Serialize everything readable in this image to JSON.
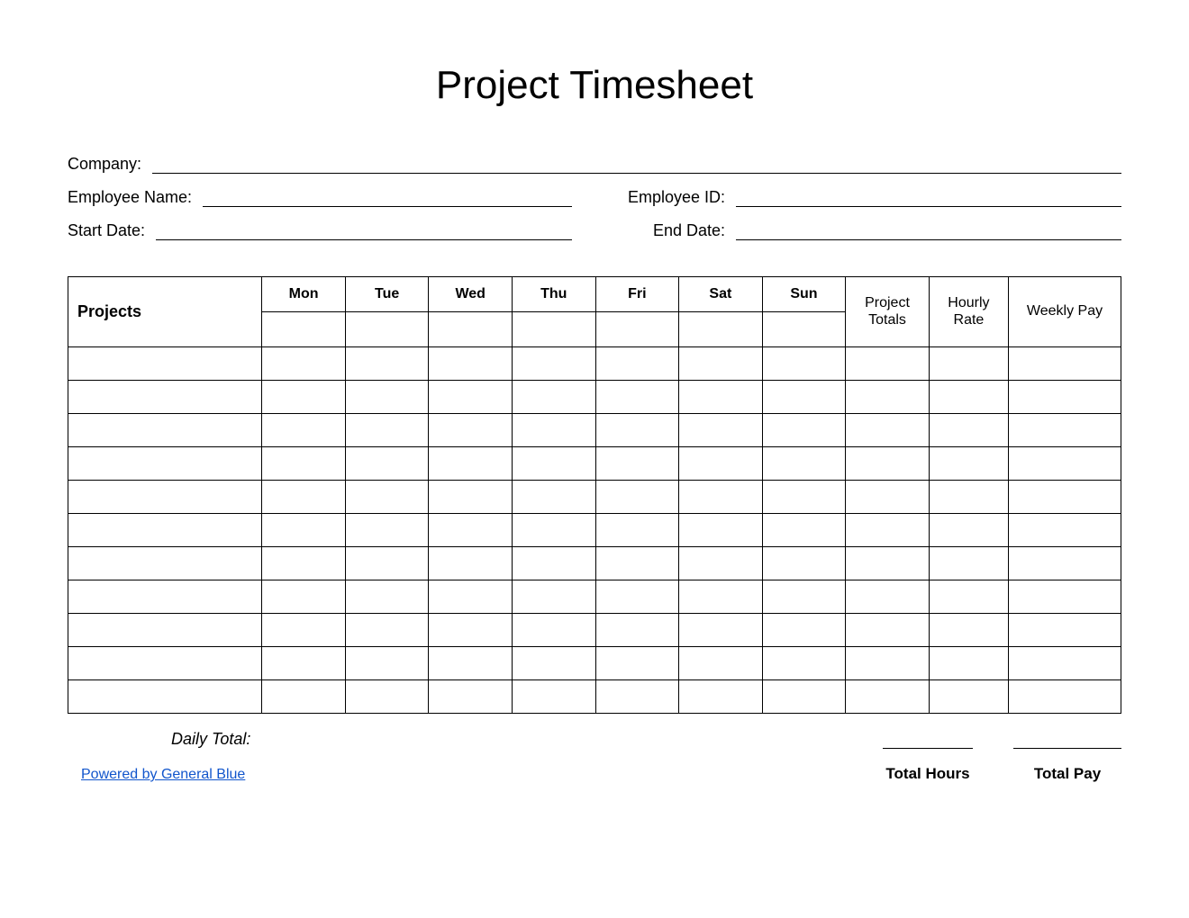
{
  "title": "Project Timesheet",
  "meta": {
    "company_label": "Company:",
    "employee_name_label": "Employee Name:",
    "employee_id_label": "Employee ID:",
    "start_date_label": "Start Date:",
    "end_date_label": "End Date:"
  },
  "table": {
    "projects_header": "Projects",
    "days": [
      "Mon",
      "Tue",
      "Wed",
      "Thu",
      "Fri",
      "Sat",
      "Sun"
    ],
    "project_totals_header": "Project Totals",
    "hourly_rate_header": "Hourly Rate",
    "weekly_pay_header": "Weekly Pay",
    "row_count": 11
  },
  "footer": {
    "daily_total_label": "Daily Total:",
    "total_hours_label": "Total Hours",
    "total_pay_label": "Total Pay",
    "powered_by": "Powered by General Blue"
  }
}
